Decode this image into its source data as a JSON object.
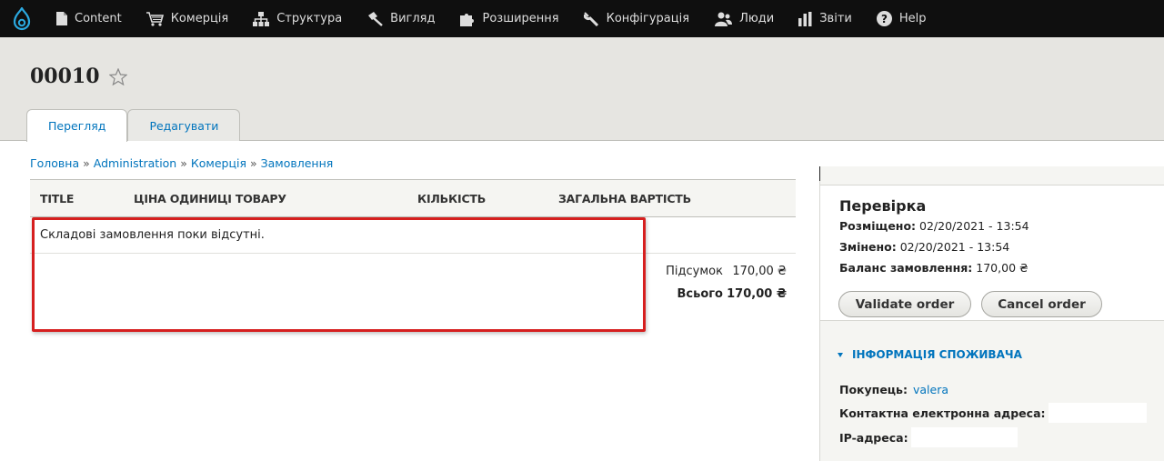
{
  "toolbar": {
    "items": [
      {
        "label": "Content",
        "icon": "file-icon"
      },
      {
        "label": "Комерція",
        "icon": "cart-icon"
      },
      {
        "label": "Структура",
        "icon": "sitemap-icon"
      },
      {
        "label": "Вигляд",
        "icon": "paint-icon"
      },
      {
        "label": "Розширення",
        "icon": "puzzle-icon"
      },
      {
        "label": "Конфігурація",
        "icon": "wrench-icon"
      },
      {
        "label": "Люди",
        "icon": "people-icon"
      },
      {
        "label": "Звіти",
        "icon": "chart-icon"
      },
      {
        "label": "Help",
        "icon": "help-icon"
      }
    ]
  },
  "page": {
    "title": "00010",
    "tabs": [
      "Перегляд",
      "Редагувати"
    ]
  },
  "breadcrumb": {
    "items": [
      "Головна",
      "Administration",
      "Комерція",
      "Замовлення"
    ],
    "separator": "»"
  },
  "order_items": {
    "headers": [
      "TITLE",
      "ЦІНА ОДИНИЦІ ТОВАРУ",
      "КІЛЬКІСТЬ",
      "ЗАГАЛЬНА ВАРТІСТЬ"
    ],
    "empty_message": "Складові замовлення поки відсутні.",
    "subtotal_label": "Підсумок",
    "subtotal_value": "170,00 ₴",
    "total_label": "Всього",
    "total_value": "170,00 ₴"
  },
  "sidebar": {
    "title": "Перевірка",
    "placed_label": "Розміщено",
    "placed_value": "02/20/2021 - 13:54",
    "changed_label": "Змінено",
    "changed_value": "02/20/2021 - 13:54",
    "balance_label": "Баланс замовлення",
    "balance_value": "170,00 ₴",
    "validate_label": "Validate order",
    "cancel_label": "Cancel order",
    "customer_heading": "ІНФОРМАЦІЯ СПОЖИВАЧА",
    "customer_label": "Покупець",
    "customer_value": "valera",
    "email_label": "Контактна електронна адреса",
    "ip_label": "IP-адреса"
  },
  "colors": {
    "link": "#0074bd",
    "toolbar_bg": "#0f0f0f",
    "highlight": "#d61f1f"
  }
}
